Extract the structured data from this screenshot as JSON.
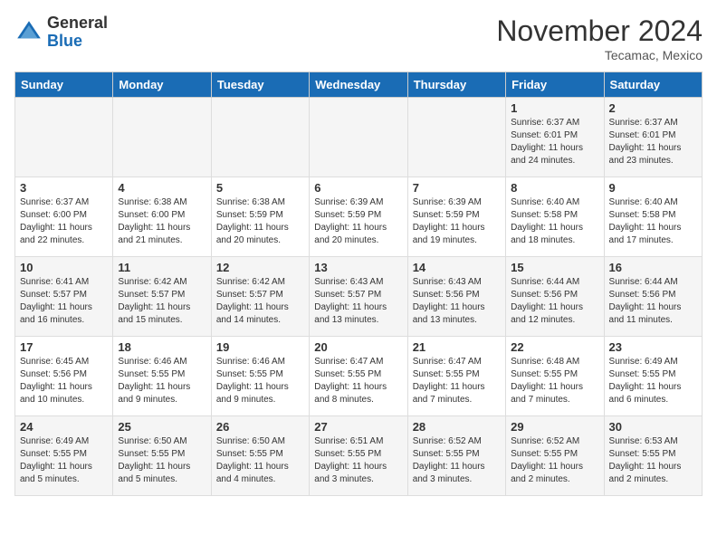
{
  "header": {
    "logo_general": "General",
    "logo_blue": "Blue",
    "month_title": "November 2024",
    "location": "Tecamac, Mexico"
  },
  "days_of_week": [
    "Sunday",
    "Monday",
    "Tuesday",
    "Wednesday",
    "Thursday",
    "Friday",
    "Saturday"
  ],
  "weeks": [
    [
      {
        "day": "",
        "info": ""
      },
      {
        "day": "",
        "info": ""
      },
      {
        "day": "",
        "info": ""
      },
      {
        "day": "",
        "info": ""
      },
      {
        "day": "",
        "info": ""
      },
      {
        "day": "1",
        "info": "Sunrise: 6:37 AM\nSunset: 6:01 PM\nDaylight: 11 hours and 24 minutes."
      },
      {
        "day": "2",
        "info": "Sunrise: 6:37 AM\nSunset: 6:01 PM\nDaylight: 11 hours and 23 minutes."
      }
    ],
    [
      {
        "day": "3",
        "info": "Sunrise: 6:37 AM\nSunset: 6:00 PM\nDaylight: 11 hours and 22 minutes."
      },
      {
        "day": "4",
        "info": "Sunrise: 6:38 AM\nSunset: 6:00 PM\nDaylight: 11 hours and 21 minutes."
      },
      {
        "day": "5",
        "info": "Sunrise: 6:38 AM\nSunset: 5:59 PM\nDaylight: 11 hours and 20 minutes."
      },
      {
        "day": "6",
        "info": "Sunrise: 6:39 AM\nSunset: 5:59 PM\nDaylight: 11 hours and 20 minutes."
      },
      {
        "day": "7",
        "info": "Sunrise: 6:39 AM\nSunset: 5:59 PM\nDaylight: 11 hours and 19 minutes."
      },
      {
        "day": "8",
        "info": "Sunrise: 6:40 AM\nSunset: 5:58 PM\nDaylight: 11 hours and 18 minutes."
      },
      {
        "day": "9",
        "info": "Sunrise: 6:40 AM\nSunset: 5:58 PM\nDaylight: 11 hours and 17 minutes."
      }
    ],
    [
      {
        "day": "10",
        "info": "Sunrise: 6:41 AM\nSunset: 5:57 PM\nDaylight: 11 hours and 16 minutes."
      },
      {
        "day": "11",
        "info": "Sunrise: 6:42 AM\nSunset: 5:57 PM\nDaylight: 11 hours and 15 minutes."
      },
      {
        "day": "12",
        "info": "Sunrise: 6:42 AM\nSunset: 5:57 PM\nDaylight: 11 hours and 14 minutes."
      },
      {
        "day": "13",
        "info": "Sunrise: 6:43 AM\nSunset: 5:57 PM\nDaylight: 11 hours and 13 minutes."
      },
      {
        "day": "14",
        "info": "Sunrise: 6:43 AM\nSunset: 5:56 PM\nDaylight: 11 hours and 13 minutes."
      },
      {
        "day": "15",
        "info": "Sunrise: 6:44 AM\nSunset: 5:56 PM\nDaylight: 11 hours and 12 minutes."
      },
      {
        "day": "16",
        "info": "Sunrise: 6:44 AM\nSunset: 5:56 PM\nDaylight: 11 hours and 11 minutes."
      }
    ],
    [
      {
        "day": "17",
        "info": "Sunrise: 6:45 AM\nSunset: 5:56 PM\nDaylight: 11 hours and 10 minutes."
      },
      {
        "day": "18",
        "info": "Sunrise: 6:46 AM\nSunset: 5:55 PM\nDaylight: 11 hours and 9 minutes."
      },
      {
        "day": "19",
        "info": "Sunrise: 6:46 AM\nSunset: 5:55 PM\nDaylight: 11 hours and 9 minutes."
      },
      {
        "day": "20",
        "info": "Sunrise: 6:47 AM\nSunset: 5:55 PM\nDaylight: 11 hours and 8 minutes."
      },
      {
        "day": "21",
        "info": "Sunrise: 6:47 AM\nSunset: 5:55 PM\nDaylight: 11 hours and 7 minutes."
      },
      {
        "day": "22",
        "info": "Sunrise: 6:48 AM\nSunset: 5:55 PM\nDaylight: 11 hours and 7 minutes."
      },
      {
        "day": "23",
        "info": "Sunrise: 6:49 AM\nSunset: 5:55 PM\nDaylight: 11 hours and 6 minutes."
      }
    ],
    [
      {
        "day": "24",
        "info": "Sunrise: 6:49 AM\nSunset: 5:55 PM\nDaylight: 11 hours and 5 minutes."
      },
      {
        "day": "25",
        "info": "Sunrise: 6:50 AM\nSunset: 5:55 PM\nDaylight: 11 hours and 5 minutes."
      },
      {
        "day": "26",
        "info": "Sunrise: 6:50 AM\nSunset: 5:55 PM\nDaylight: 11 hours and 4 minutes."
      },
      {
        "day": "27",
        "info": "Sunrise: 6:51 AM\nSunset: 5:55 PM\nDaylight: 11 hours and 3 minutes."
      },
      {
        "day": "28",
        "info": "Sunrise: 6:52 AM\nSunset: 5:55 PM\nDaylight: 11 hours and 3 minutes."
      },
      {
        "day": "29",
        "info": "Sunrise: 6:52 AM\nSunset: 5:55 PM\nDaylight: 11 hours and 2 minutes."
      },
      {
        "day": "30",
        "info": "Sunrise: 6:53 AM\nSunset: 5:55 PM\nDaylight: 11 hours and 2 minutes."
      }
    ]
  ]
}
